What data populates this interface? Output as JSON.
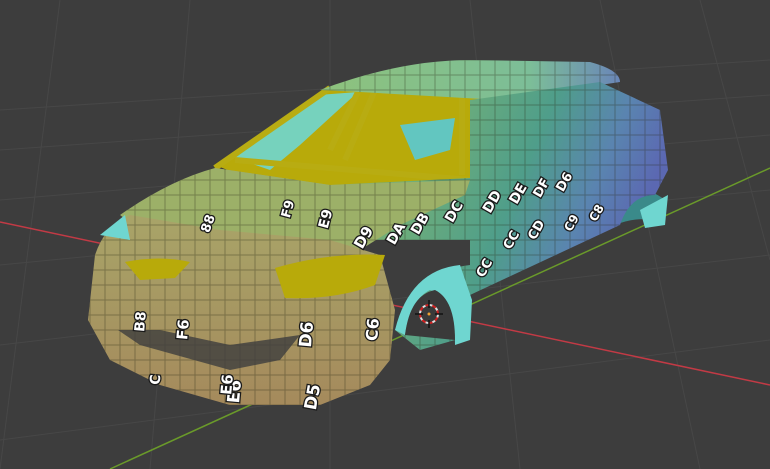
{
  "app": "3D viewport",
  "scene": {
    "background": "#3d3d3d",
    "grid_color": "#4a4a4a",
    "x_axis_color": "#c23a45",
    "y_axis_color": "#6a9a2a",
    "object": "car-body-mesh",
    "material": "uv-grid-checker",
    "interior_color": "#b8aa0a",
    "glass_color": "#6fd6d0"
  },
  "uv_labels": [
    {
      "text": "D5"
    },
    {
      "text": "E6"
    },
    {
      "text": "D6"
    },
    {
      "text": "C6"
    },
    {
      "text": "F6"
    },
    {
      "text": "B8"
    },
    {
      "text": "E9"
    },
    {
      "text": "F9"
    },
    {
      "text": "88"
    },
    {
      "text": "D9"
    },
    {
      "text": "DA"
    },
    {
      "text": "DB"
    },
    {
      "text": "DC"
    },
    {
      "text": "DD"
    },
    {
      "text": "DE"
    },
    {
      "text": "DF"
    },
    {
      "text": "D6"
    },
    {
      "text": "CC"
    },
    {
      "text": "CC"
    },
    {
      "text": "CD"
    },
    {
      "text": "C8"
    },
    {
      "text": "C9"
    },
    {
      "text": "E6"
    },
    {
      "text": "C"
    }
  ]
}
